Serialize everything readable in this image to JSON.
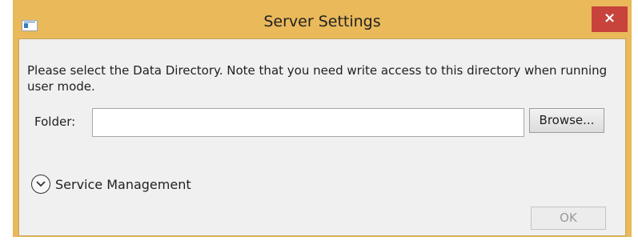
{
  "window": {
    "title": "Server Settings",
    "close_label": "×"
  },
  "dialog": {
    "note": "Please select the Data Directory. Note that you need write access to this directory when running user mode.",
    "folder_label": "Folder:",
    "folder_value": "",
    "browse_label": "Browse...",
    "service_label": "Service Management",
    "ok_label": "OK",
    "ok_enabled": false
  },
  "icons": {
    "app": "app-window-icon",
    "close": "close-icon",
    "expand": "chevron-down-circle-icon"
  },
  "colors": {
    "titlebar": "#e9b95a",
    "close_button": "#c7433b",
    "client_background": "#f0f0f0"
  }
}
